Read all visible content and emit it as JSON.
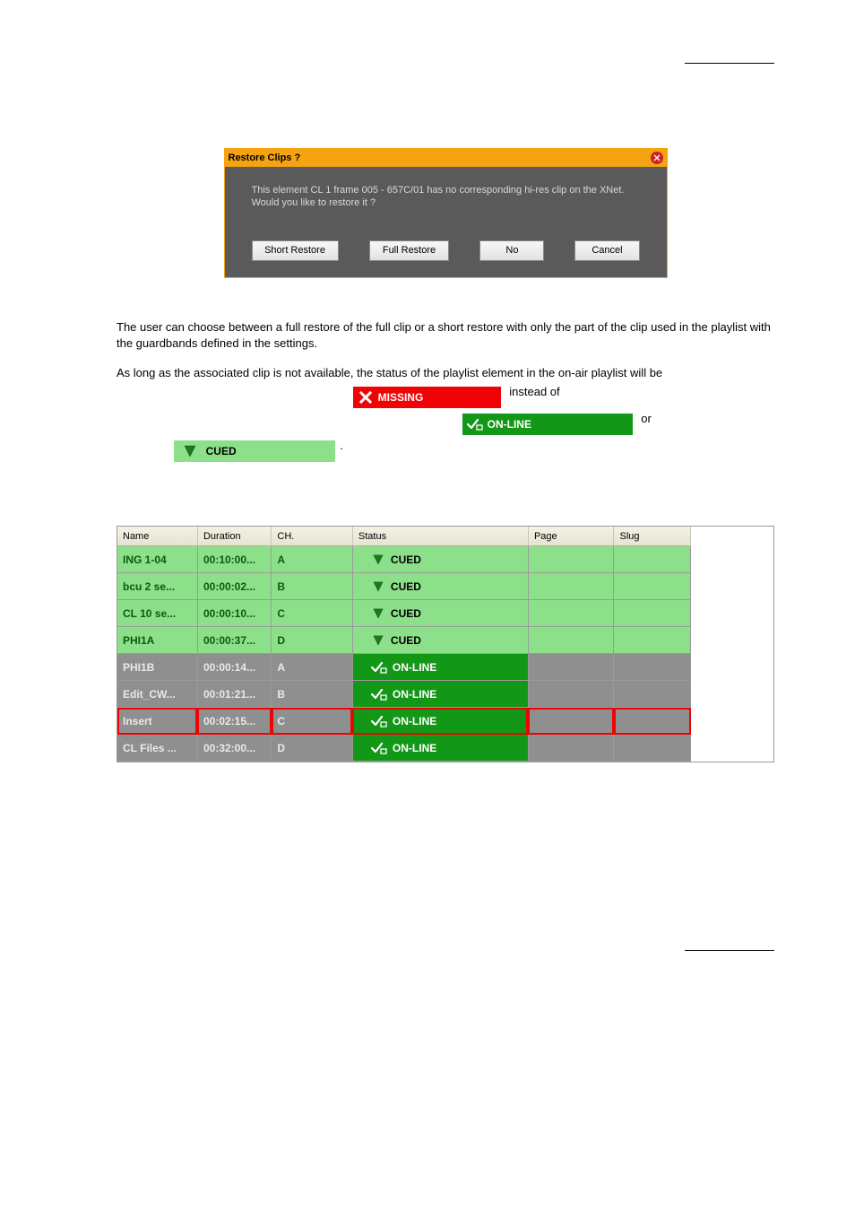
{
  "dialog": {
    "title": "Restore Clips ?",
    "message_line1": "This element CL 1 frame 005 - 657C/01 has no corresponding hi-res clip on the XNet.",
    "message_line2": "Would you like to restore it ?",
    "buttons": {
      "short_restore": "Short Restore",
      "full_restore": "Full Restore",
      "no": "No",
      "cancel": "Cancel"
    }
  },
  "paragraphs": {
    "p1": "The user can choose between a full restore of the full clip or a short restore with only the part of the clip used in the playlist with the guardbands defined in the settings.",
    "p2a": "As long as the associated clip is not available, the status of the playlist element in the on-air playlist will be ",
    "p2b": " instead of ",
    "p2c": " or",
    "p2d": "."
  },
  "badges": {
    "missing": "MISSING",
    "online": "ON-LINE",
    "cued": "CUED"
  },
  "table": {
    "headers": {
      "name": "Name",
      "duration": "Duration",
      "ch": "CH.",
      "status": "Status",
      "page": "Page",
      "slug": "Slug"
    },
    "rows": [
      {
        "name": "ING 1-04",
        "duration": "00:10:00...",
        "ch": "A",
        "status": "CUED",
        "status_type": "cued",
        "highlight": false
      },
      {
        "name": "bcu 2 se...",
        "duration": "00:00:02...",
        "ch": "B",
        "status": "CUED",
        "status_type": "cued",
        "highlight": false
      },
      {
        "name": "CL 10 se...",
        "duration": "00:00:10...",
        "ch": "C",
        "status": "CUED",
        "status_type": "cued",
        "highlight": false
      },
      {
        "name": "PHI1A",
        "duration": "00:00:37...",
        "ch": "D",
        "status": "CUED",
        "status_type": "cued",
        "highlight": false
      },
      {
        "name": "PHI1B",
        "duration": "00:00:14...",
        "ch": "A",
        "status": "ON-LINE",
        "status_type": "online",
        "highlight": false
      },
      {
        "name": "Edit_CW...",
        "duration": "00:01:21...",
        "ch": "B",
        "status": "ON-LINE",
        "status_type": "online",
        "highlight": false
      },
      {
        "name": "Insert",
        "duration": "00:02:15...",
        "ch": "C",
        "status": "ON-LINE",
        "status_type": "online",
        "highlight": true
      },
      {
        "name": "CL Files ...",
        "duration": "00:32:00...",
        "ch": "D",
        "status": "ON-LINE",
        "status_type": "online",
        "highlight": false
      }
    ]
  }
}
